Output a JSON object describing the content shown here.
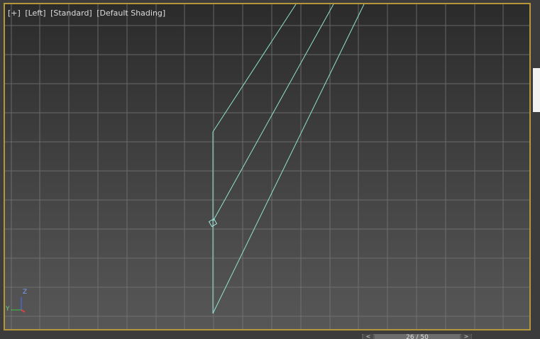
{
  "viewport": {
    "labels": {
      "plus": "[+]",
      "view": "[Left]",
      "mode": "[Standard]",
      "shading": "[Default Shading]"
    },
    "axis_gizmo": {
      "up_axis": "Z",
      "side_axis": "Y"
    },
    "colors": {
      "border_active": "#b6963a",
      "grid": "#7a7a7a",
      "wire": "#8fe3cf",
      "axis_z": "#4a6cff",
      "axis_y": "#3fbf3f",
      "axis_x": "#e04040"
    }
  },
  "timeline": {
    "prev_label": "<",
    "next_label": ">",
    "frame_text": "26 / 50"
  }
}
